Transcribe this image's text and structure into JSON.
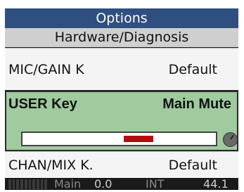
{
  "header": {
    "title": "Options",
    "subtitle": "Hardware/Diagnosis"
  },
  "rows": {
    "mic": {
      "label": "MIC/GAIN K",
      "value": "Default"
    },
    "user": {
      "label": "USER Key",
      "value": "Main Mute",
      "slider_fraction": 0.6
    },
    "chan": {
      "label": "CHAN/MIX K.",
      "value": "Default"
    }
  },
  "status": {
    "main_label": "Main",
    "gain": "0.0",
    "int_label": "INT",
    "rate": "44.1"
  },
  "colors": {
    "title_bar": "#2f4f80",
    "subtitle_bar": "#cfcfcf",
    "selected_row": "#9fcb9f",
    "slider_thumb": "#b01010"
  }
}
